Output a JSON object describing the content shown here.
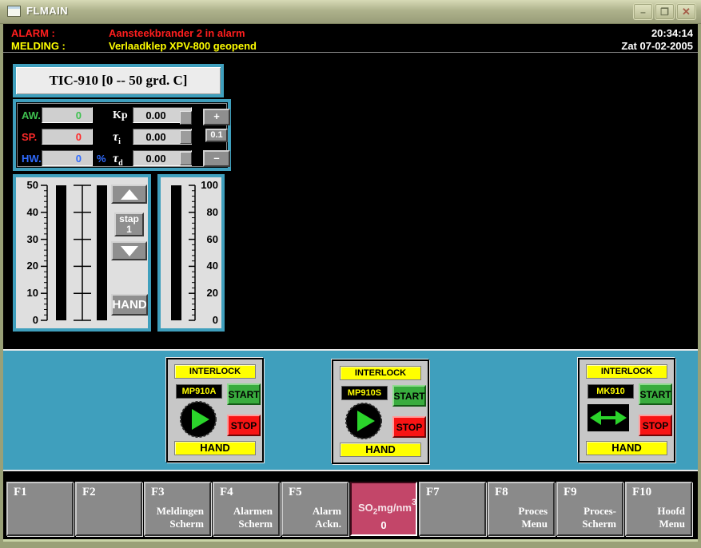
{
  "window": {
    "title": "FLMAIN",
    "icons": {
      "minimize": "–",
      "maximize": "❐",
      "close": "✕"
    }
  },
  "alarm_bar": {
    "alarm_label": "ALARM :",
    "alarm_text": "Aansteekbrander 2 in alarm",
    "melding_label": "MELDING :",
    "melding_text": "Verlaadklep XPV-800 geopend",
    "time": "20:34:14",
    "date": "Zat 07-02-2005"
  },
  "controller": {
    "title": "TIC-910  [0 -- 50 grd. C]",
    "rows": {
      "aw": {
        "label": "AW.",
        "value": "0"
      },
      "sp": {
        "label": "SP.",
        "value": "0"
      },
      "hw": {
        "label": "HW.",
        "value": "0",
        "unit": "%"
      }
    },
    "params": [
      {
        "label": "Kp",
        "sub": "",
        "value": "0.00"
      },
      {
        "label": "τ",
        "sub": "i",
        "value": "0.00"
      },
      {
        "label": "τ",
        "sub": "d",
        "value": "0.00"
      }
    ],
    "adjust_buttons": [
      "+",
      "0.1",
      "–"
    ],
    "stepper": {
      "up_icon": "▲",
      "step_word": "stap",
      "step_value": "1",
      "down_icon": "▼",
      "hand": "HAND"
    },
    "left_scale": {
      "ticks": [
        "50",
        "40",
        "30",
        "20",
        "10",
        "0"
      ]
    },
    "right_scale": {
      "ticks": [
        "100",
        "80",
        "60",
        "40",
        "20",
        "0"
      ]
    }
  },
  "interlocks": [
    {
      "header": "INTERLOCK",
      "tag": "MP910A",
      "start": "START",
      "stop": "STOP",
      "mode": "HAND",
      "indicator": "pump-running"
    },
    {
      "header": "INTERLOCK",
      "tag": "MP910S",
      "start": "START",
      "stop": "STOP",
      "mode": "HAND",
      "indicator": "pump-running"
    },
    {
      "header": "INTERLOCK",
      "tag": "MK910",
      "start": "START",
      "stop": "STOP",
      "mode": "HAND",
      "indicator": "mixer-running"
    }
  ],
  "so2_display": {
    "prefix": "SO",
    "sub": "2",
    "unit": "mg/nm",
    "sup": "3",
    "value": "0"
  },
  "function_keys": [
    {
      "key": "F1",
      "line1": "",
      "line2": ""
    },
    {
      "key": "F2",
      "line1": "",
      "line2": ""
    },
    {
      "key": "F3",
      "line1": "Meldingen",
      "line2": "Scherm"
    },
    {
      "key": "F4",
      "line1": "Alarmen",
      "line2": "Scherm"
    },
    {
      "key": "F5",
      "line1": "Alarm",
      "line2": "Ackn."
    },
    {
      "key": "F7",
      "line1": "",
      "line2": ""
    },
    {
      "key": "F8",
      "line1": "Proces",
      "line2": "Menu"
    },
    {
      "key": "F9",
      "line1": "Proces-",
      "line2": "Scherm"
    },
    {
      "key": "F10",
      "line1": "Hoofd",
      "line2": "Menu"
    }
  ],
  "colors": {
    "teal": "#3F9FBD",
    "alarm_red": "#FF1E1E",
    "message_yellow": "#FFFF00",
    "start_green": "#39AC3E",
    "stop_red": "#F81414",
    "indicator_green": "#2BD42B",
    "so2_crimson": "#C34669",
    "titlebar_olive": "#AEB28C"
  }
}
